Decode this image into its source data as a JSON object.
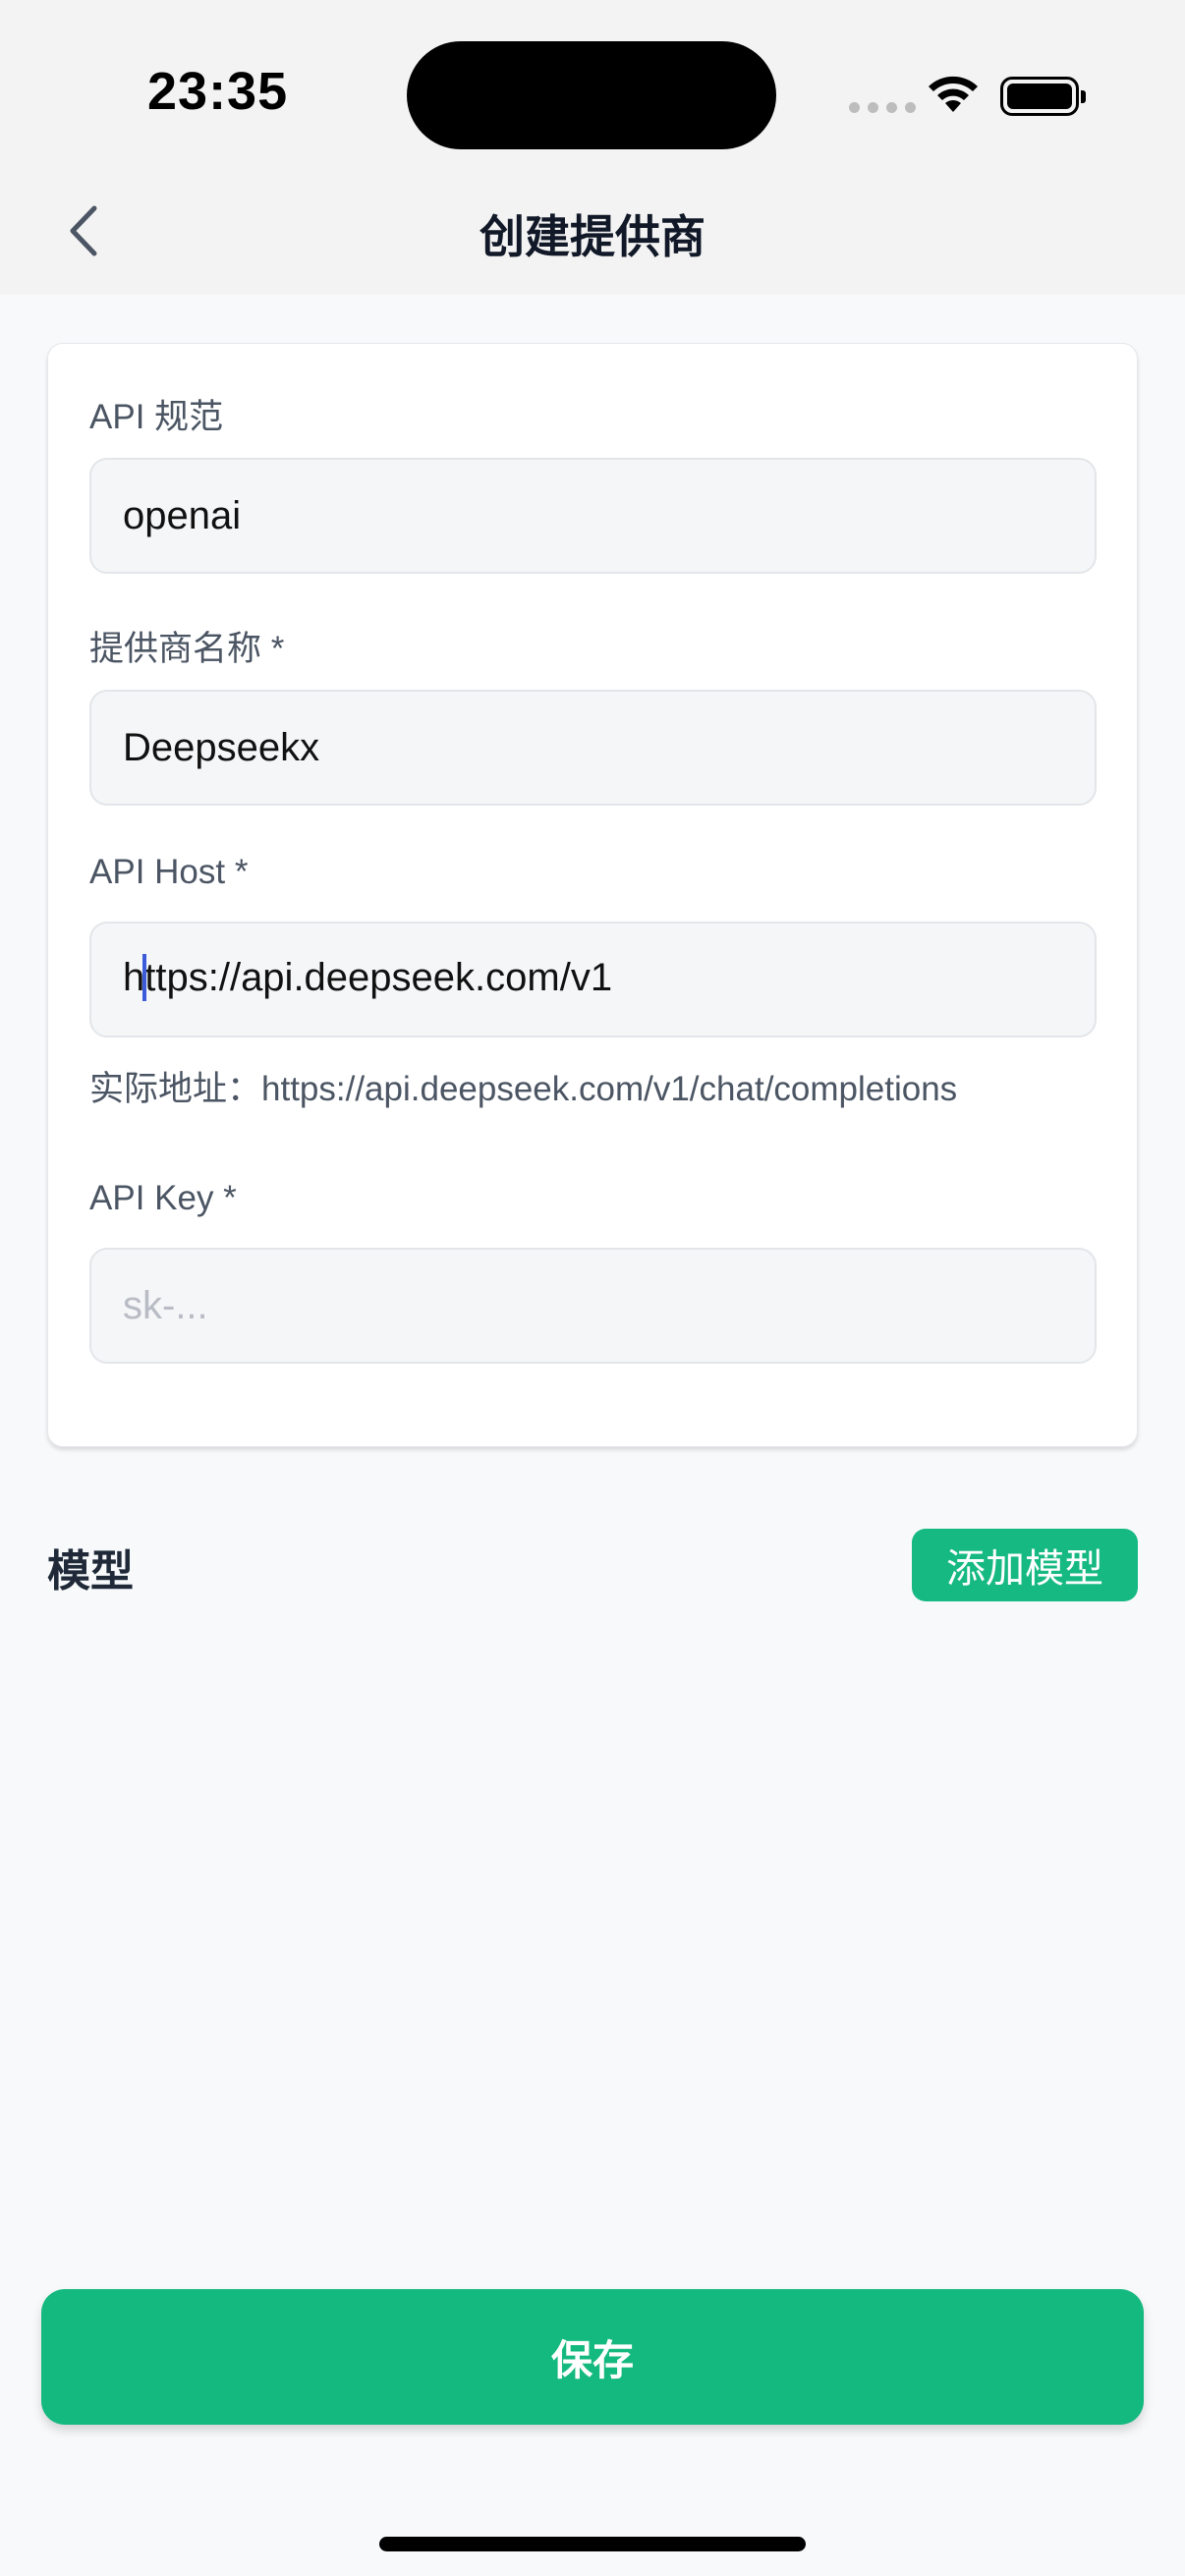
{
  "status_bar": {
    "time": "23:35"
  },
  "header": {
    "title": "创建提供商"
  },
  "form": {
    "api_spec": {
      "label": "API 规范",
      "value": "openai"
    },
    "provider_name": {
      "label": "提供商名称 *",
      "value": "Deepseekx"
    },
    "api_host": {
      "label": "API Host *",
      "value_before_caret": "h",
      "value_after_caret": "ttps://api.deepseek.com/v1",
      "hint": "实际地址：https://api.deepseek.com/v1/chat/completions"
    },
    "api_key": {
      "label": "API Key *",
      "placeholder": "sk-..."
    }
  },
  "models": {
    "title": "模型",
    "add_label": "添加模型"
  },
  "actions": {
    "save_label": "保存"
  },
  "colors": {
    "accent": "#14b97f",
    "caret": "#3b5bdb"
  }
}
